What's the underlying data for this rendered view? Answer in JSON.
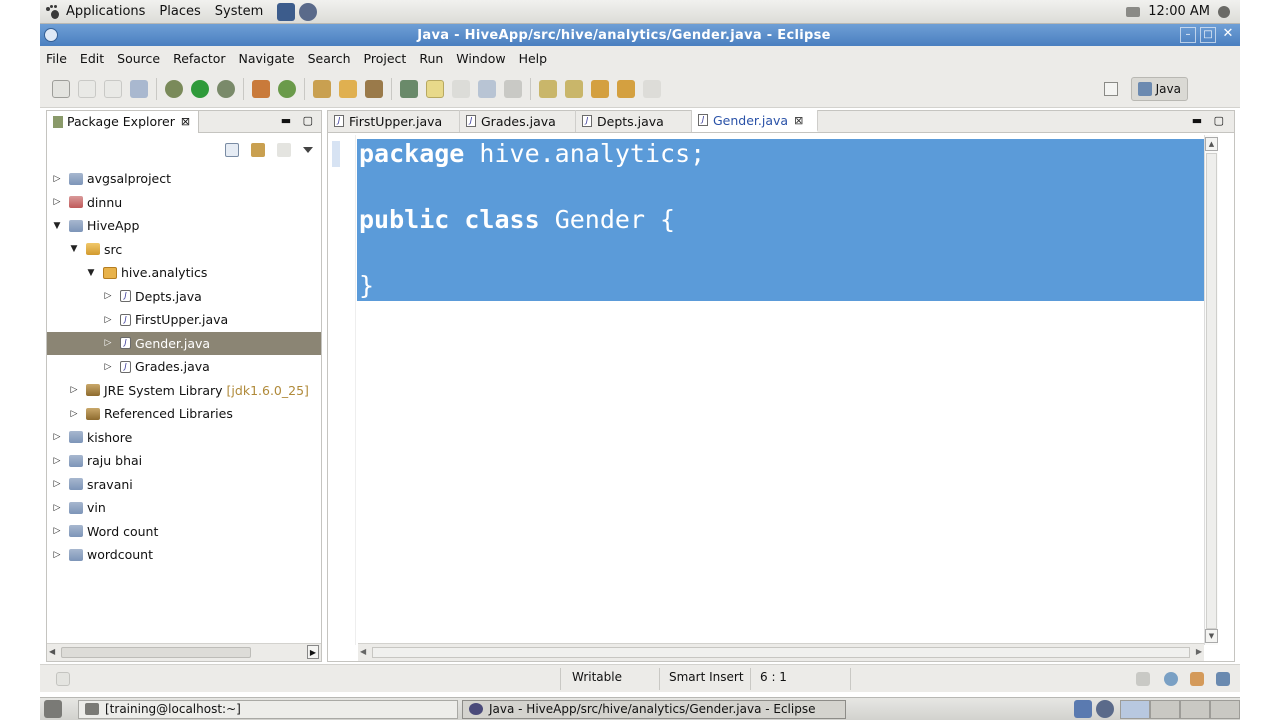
{
  "top_panel": {
    "menus": [
      "Applications",
      "Places",
      "System"
    ],
    "clock": "12:00 AM"
  },
  "window": {
    "title": "Java - HiveApp/src/hive/analytics/Gender.java - Eclipse"
  },
  "menubar": [
    "File",
    "Edit",
    "Source",
    "Refactor",
    "Navigate",
    "Search",
    "Project",
    "Run",
    "Window",
    "Help"
  ],
  "toolbar": {
    "perspective_label": "Java"
  },
  "package_explorer": {
    "title": "Package Explorer",
    "items": [
      {
        "label": "avgsalproject",
        "depth": 0,
        "expanded": false,
        "icon": "project"
      },
      {
        "label": "dinnu",
        "depth": 0,
        "expanded": false,
        "icon": "project-error"
      },
      {
        "label": "HiveApp",
        "depth": 0,
        "expanded": true,
        "icon": "project"
      },
      {
        "label": "src",
        "depth": 1,
        "expanded": true,
        "icon": "source-folder"
      },
      {
        "label": "hive.analytics",
        "depth": 2,
        "expanded": true,
        "icon": "package",
        "no_twisty": false
      },
      {
        "label": "Depts.java",
        "depth": 3,
        "expanded": false,
        "icon": "java-file"
      },
      {
        "label": "FirstUpper.java",
        "depth": 3,
        "expanded": false,
        "icon": "java-file"
      },
      {
        "label": "Gender.java",
        "depth": 3,
        "expanded": false,
        "icon": "java-file",
        "selected": true
      },
      {
        "label": "Grades.java",
        "depth": 3,
        "expanded": false,
        "icon": "java-file"
      },
      {
        "label": "JRE System Library",
        "decor": "[jdk1.6.0_25]",
        "depth": 1,
        "expanded": false,
        "icon": "library"
      },
      {
        "label": "Referenced Libraries",
        "depth": 1,
        "expanded": false,
        "icon": "library"
      },
      {
        "label": "kishore",
        "depth": 0,
        "expanded": false,
        "icon": "project"
      },
      {
        "label": "raju bhai",
        "depth": 0,
        "expanded": false,
        "icon": "project"
      },
      {
        "label": "sravani",
        "depth": 0,
        "expanded": false,
        "icon": "project"
      },
      {
        "label": "vin",
        "depth": 0,
        "expanded": false,
        "icon": "project"
      },
      {
        "label": "Word count",
        "depth": 0,
        "expanded": false,
        "icon": "project"
      },
      {
        "label": "wordcount",
        "depth": 0,
        "expanded": false,
        "icon": "project"
      }
    ]
  },
  "editor": {
    "tabs": [
      {
        "label": "FirstUpper.java",
        "active": false
      },
      {
        "label": "Grades.java",
        "active": false
      },
      {
        "label": "Depts.java",
        "active": false
      },
      {
        "label": "Gender.java",
        "active": true
      }
    ],
    "code": {
      "line1_kw": "package",
      "line1_rest": " hive.analytics;",
      "line3_kw1": "public",
      "line3_kw2": "class",
      "line3_rest": " Gender {",
      "line5": "}"
    }
  },
  "statusbar": {
    "mode": "Writable",
    "insert": "Smart Insert",
    "position": "6 : 1"
  },
  "taskbar": {
    "tasks": [
      {
        "label": "[training@localhost:~]",
        "active": false
      },
      {
        "label": "Java - HiveApp/src/hive/analytics/Gender.java - Eclipse",
        "active": true
      }
    ]
  },
  "colors": {
    "selection": "#5b9bd9",
    "titlebar": "#4a7fc0",
    "tree_selected": "#8b8574"
  }
}
